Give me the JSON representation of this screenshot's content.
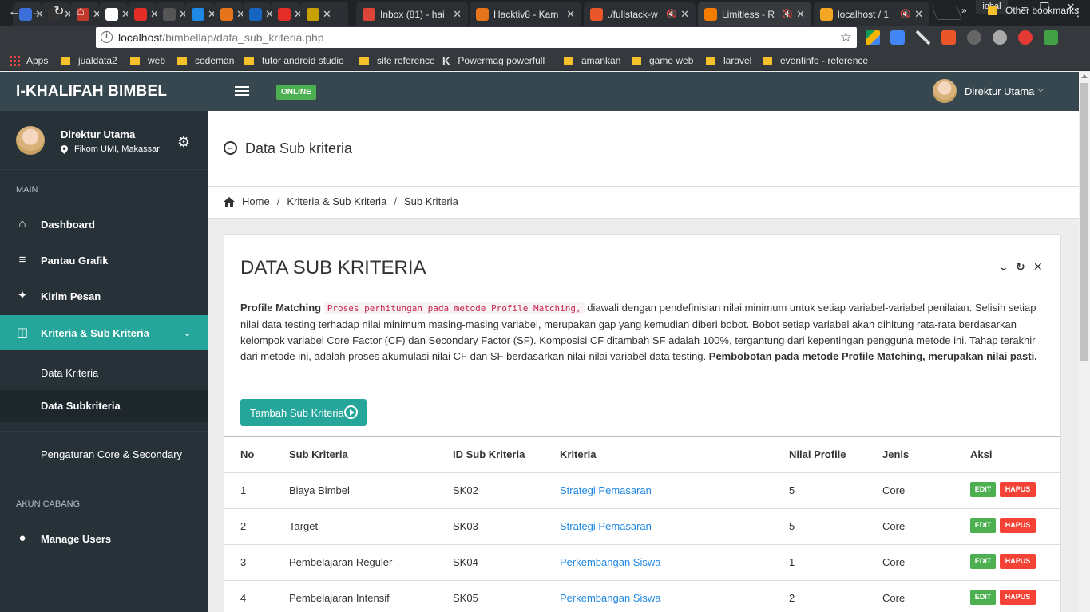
{
  "browser": {
    "tabs": [
      {
        "title": "",
        "color": "#3d6fd8"
      },
      {
        "title": "",
        "color": "#333333"
      },
      {
        "title": "",
        "color": "#c0392b"
      },
      {
        "title": "",
        "color": "#ffffff"
      },
      {
        "title": "",
        "color": "#e52d27"
      },
      {
        "title": "",
        "color": "#555555"
      },
      {
        "title": "",
        "color": "#1e88e5"
      },
      {
        "title": "",
        "color": "#e6741b"
      },
      {
        "title": "",
        "color": "#1565c0"
      },
      {
        "title": "",
        "color": "#e52d27"
      },
      {
        "title": "",
        "color": "#c8a000"
      },
      {
        "title": "Inbox (81) - hai",
        "color": "#db4437"
      },
      {
        "title": "Hacktiv8 - Kam",
        "color": "#e6741b"
      },
      {
        "title": "./fullstack-w",
        "color": "#e8562a"
      },
      {
        "title": "Limitless - R",
        "color": "#f57c00"
      },
      {
        "title": "localhost / 1",
        "color": "#f5a623"
      }
    ],
    "profile": "iqbal",
    "url_host": "localhost",
    "url_path": "/bimbellap/data_sub_kriteria.php",
    "bookmarks": [
      {
        "label": "Apps",
        "kind": "apps"
      },
      {
        "label": "jualdata2",
        "kind": "folder"
      },
      {
        "label": "web",
        "kind": "folder"
      },
      {
        "label": "codeman",
        "kind": "folder"
      },
      {
        "label": "tutor android studio",
        "kind": "folder"
      },
      {
        "label": "site reference",
        "kind": "folder"
      },
      {
        "label": "Powermag powerfull",
        "kind": "k"
      },
      {
        "label": "amankan",
        "kind": "folder"
      },
      {
        "label": "game web",
        "kind": "folder"
      },
      {
        "label": "laravel",
        "kind": "folder"
      },
      {
        "label": "eventinfo - reference",
        "kind": "folder"
      }
    ],
    "more_bookmarks": "»",
    "other_bookmarks": "Other bookmarks"
  },
  "app": {
    "brand": "I-KHALIFAH BIMBEL",
    "status_badge": "ONLINE",
    "top_user": "Direktur Utama"
  },
  "sidebar": {
    "user_name": "Direktur Utama",
    "user_location": "Fikom UMI, Makassar",
    "heading_main": "MAIN",
    "heading_cabang": "AKUN CABANG",
    "items": {
      "dashboard": "Dashboard",
      "pantau": "Pantau Grafik",
      "kirim": "Kirim Pesan",
      "kriteria": "Kriteria & Sub Kriteria",
      "data_kriteria": "Data Kriteria",
      "data_subkriteria": "Data Subkriteria",
      "pengaturan": "Pengaturan Core & Secondary",
      "manage_users": "Manage Users"
    }
  },
  "page": {
    "title": "Data Sub kriteria",
    "breadcrumb": [
      "Home",
      "Kriteria & Sub Kriteria",
      "Sub Kriteria"
    ]
  },
  "panel": {
    "title": "DATA SUB KRITERIA",
    "desc_bold": "Profile Matching",
    "desc_code": "Proses perhitungan pada metode Profile Matching,",
    "desc_text": "diawali dengan pendefinisian nilai minimum untuk setiap variabel-variabel penilaian. Selisih setiap nilai data testing terhadap nilai minimum masing-masing variabel, merupakan gap yang kemudian diberi bobot. Bobot setiap variabel akan dihitung rata-rata berdasarkan kelompok variabel Core Factor (CF) dan Secondary Factor (SF). Komposisi CF ditambah SF adalah 100%, tergantung dari kepentingan pengguna metode ini. Tahap terakhir dari metode ini, adalah proses akumulasi nilai CF dan SF berdasarkan nilai-nilai variabel data testing.",
    "desc_end_bold": "Pembobotan pada metode Profile Matching, merupakan nilai pasti.",
    "add_button": "Tambah Sub Kriteria"
  },
  "table": {
    "headers": {
      "no": "No",
      "sub": "Sub Kriteria",
      "id": "ID Sub Kriteria",
      "kriteria": "Kriteria",
      "nilai": "Nilai Profile",
      "jenis": "Jenis",
      "aksi": "Aksi"
    },
    "edit_label": "EDIT",
    "delete_label": "HAPUS",
    "rows": [
      {
        "no": "1",
        "sub": "Biaya Bimbel",
        "id": "SK02",
        "kriteria": "Strategi Pemasaran",
        "nilai": "5",
        "jenis": "Core"
      },
      {
        "no": "2",
        "sub": "Target",
        "id": "SK03",
        "kriteria": "Strategi Pemasaran",
        "nilai": "5",
        "jenis": "Core"
      },
      {
        "no": "3",
        "sub": "Pembelajaran Reguler",
        "id": "SK04",
        "kriteria": "Perkembangan Siswa",
        "nilai": "1",
        "jenis": "Core"
      },
      {
        "no": "4",
        "sub": "Pembelajaran Intensif",
        "id": "SK05",
        "kriteria": "Perkembangan Siswa",
        "nilai": "2",
        "jenis": "Core"
      }
    ]
  }
}
